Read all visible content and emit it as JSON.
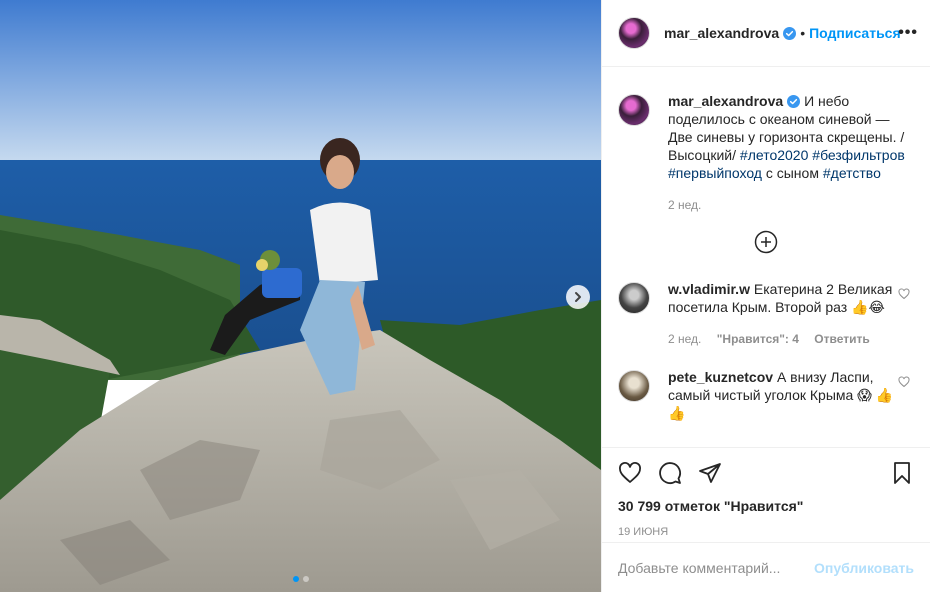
{
  "post": {
    "author": "mar_alexandrova",
    "follow_label": "Подписаться",
    "dot": "•",
    "more": "•••",
    "caption": {
      "text_before": "И небо поделилось с океаном синевой — Две синевы у горизонта скрещены. / Высоцкий/",
      "tag1": "#лето2020",
      "tag2": "#безфильтров",
      "tag3": "#первыйпоход",
      "text_mid": "с сыном",
      "tag4": "#детство",
      "time": "2 нед."
    },
    "carousel": {
      "slides": 2,
      "active": 1
    }
  },
  "comments": [
    {
      "username": "w.vladimir.w",
      "text": "Екатерина 2 Великая посетила Крым. Второй раз 👍😂",
      "time": "2 нед.",
      "likes": "\"Нравится\": 4",
      "reply": "Ответить"
    },
    {
      "username": "pete_kuznetcov",
      "text": "А внизу Ласпи, самый чистый уголок Крыма 😱",
      "tail": "👍👍"
    }
  ],
  "stats": {
    "likes": "30 799 отметок \"Нравится\"",
    "date": "19 июня"
  },
  "add_comment": {
    "placeholder": "Добавьте комментарий...",
    "publish": "Опубликовать"
  },
  "colors": {
    "accent": "#0095f6",
    "hashtag": "#00376b",
    "muted": "#8e8e8e"
  }
}
